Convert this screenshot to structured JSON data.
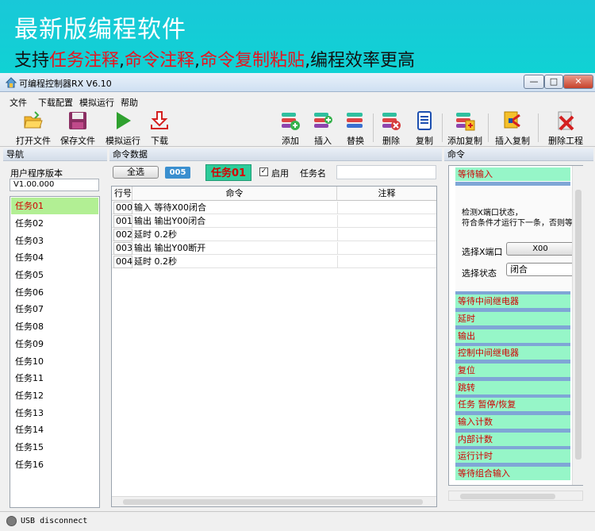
{
  "banner": {
    "line1": "最新版编程软件",
    "line2_parts": [
      "支持",
      "任务注释",
      ",",
      "命令注释",
      ",",
      "命令复制粘贴",
      ",编程效率更高"
    ]
  },
  "window": {
    "title": "可编程控制器RX V6.10",
    "min": "—",
    "max": "□",
    "close": "✕"
  },
  "menu": [
    "文件",
    "下载配置",
    "模拟运行",
    "帮助"
  ],
  "toolbar": {
    "open": "打开文件",
    "save": "保存文件",
    "simulate": "模拟运行",
    "download": "下载",
    "add": "添加",
    "insert": "插入",
    "replace": "替换",
    "delete": "删除",
    "copy": "复制",
    "add_copy": "添加复制",
    "insert_copy": "插入复制",
    "delete_project": "删除工程"
  },
  "nav": {
    "header": "导航",
    "version_label": "用户程序版本",
    "version_value": "V1.00.000",
    "tasks": [
      "任务01",
      "任务02",
      "任务03",
      "任务04",
      "任务05",
      "任务06",
      "任务07",
      "任务08",
      "任务09",
      "任务10",
      "任务11",
      "任务12",
      "任务13",
      "任务14",
      "任务15",
      "任务16"
    ],
    "selected": 0
  },
  "commands": {
    "header": "命令数据",
    "select_all": "全选",
    "count": "005",
    "task_title": "任务01",
    "enable_label": "启用",
    "enable_check": "✓",
    "task_name_label": "任务名",
    "columns": [
      "行号",
      "命令",
      "注释"
    ],
    "rows": [
      {
        "no": "000",
        "cmd": "输入 等待X00闭合"
      },
      {
        "no": "001",
        "cmd": "输出 输出Y00闭合"
      },
      {
        "no": "002",
        "cmd": "延时 0.2秒"
      },
      {
        "no": "003",
        "cmd": "输出 输出Y00断开"
      },
      {
        "no": "004",
        "cmd": "延时 0.2秒"
      }
    ]
  },
  "palette": {
    "header": "命令",
    "active": "等待输入",
    "desc1": "检测X端口状态，",
    "desc2": "符合条件才运行下一条，否则等",
    "port_label": "选择X端口",
    "port_value": "X00",
    "state_label": "选择状态",
    "state_value": "闭合",
    "categories": [
      "等待中间继电器",
      "延时",
      "输出",
      "控制中间继电器",
      "复位",
      "跳转",
      "任务 暂停/恢复",
      "输入计数",
      "内部计数",
      "运行计时",
      "等待组合输入"
    ]
  },
  "status": {
    "text": "USB disconnect"
  },
  "colors": {
    "banner": "#19c8d8",
    "highlight_red": "#e8131d",
    "selected_task": "#b2ef94",
    "category": "#96f6c8",
    "task_title_bg": "#2dcc9a"
  }
}
